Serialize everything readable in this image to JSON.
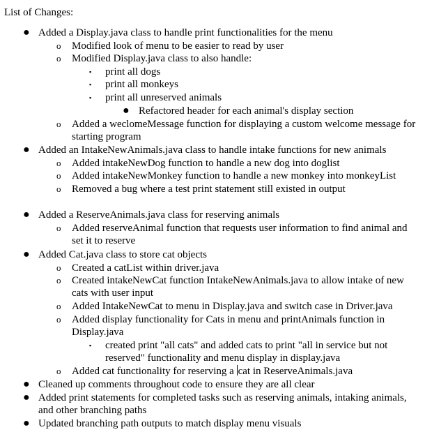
{
  "heading": "List of Changes:",
  "lines": [
    {
      "id": "l1",
      "text": "Added a Display.java class to handle print functionalities for the menu"
    },
    {
      "id": "l2",
      "text": "Modified look of menu to be easier to read by user"
    },
    {
      "id": "l3",
      "text": "Modified Display.java class to also handle:"
    },
    {
      "id": "l4",
      "text": "print all dogs"
    },
    {
      "id": "l5",
      "text": "print all monkeys"
    },
    {
      "id": "l6",
      "text": "print all unreserved animals"
    },
    {
      "id": "l7",
      "text": "Refactored header for each animal's display section"
    },
    {
      "id": "l8",
      "text": "Added a weclomeMessage function for displaying a custom welcome message for"
    },
    {
      "id": "l8b",
      "text": "starting program"
    },
    {
      "id": "l9",
      "text": "Added an IntakeNewAnimals.java class to handle intake functions for new animals"
    },
    {
      "id": "l10",
      "text": "Added intakeNewDog function to handle a new dog into doglist"
    },
    {
      "id": "l11",
      "text": "Added intakeNewMonkey function to handle a new monkey into monkeyList"
    },
    {
      "id": "l12",
      "text": "Removed a bug where a test print statement still existed in output"
    },
    {
      "id": "l13",
      "text": "Added a ReserveAnimals.java class for reserving animals"
    },
    {
      "id": "l14",
      "text": "Added reserveAnimal function that requests user information to find animal and"
    },
    {
      "id": "l14b",
      "text": "set it to reserve"
    },
    {
      "id": "l15",
      "text": "Added Cat.java class to store cat objects"
    },
    {
      "id": "l16",
      "text": "Created a catList within driver.java"
    },
    {
      "id": "l17",
      "text": "Created intakeNewCat function IntakeNewAnimals.java to allow intake of new"
    },
    {
      "id": "l17b",
      "text": "cats with user input"
    },
    {
      "id": "l18",
      "text": "Added IntakeNewCat to menu in Display.java and switch case in Driver.java"
    },
    {
      "id": "l19",
      "text": "Added display functionality for Cats in menu and printAnimals function in"
    },
    {
      "id": "l19b",
      "text": "Display.java"
    },
    {
      "id": "l20",
      "text": "created print \"all cats\" and added cats to print \"all in service but not"
    },
    {
      "id": "l20b",
      "text": "reserved\" functionality and menu display in display.java"
    },
    {
      "id": "l21a",
      "text": "Added cat functionality for reserving a "
    },
    {
      "id": "l21b",
      "text": "cat in ReserveAnimals.java"
    },
    {
      "id": "l22",
      "text": "Cleaned up comments throughout code to ensure they are all clear"
    },
    {
      "id": "l23",
      "text": "Added print statements for completed tasks such as reserving animals, intaking animals,"
    },
    {
      "id": "l23b",
      "text": "and other branching paths"
    },
    {
      "id": "l24",
      "text": "Updated branching path outputs to match display menu visuals"
    }
  ],
  "bullets": {
    "level1": "●",
    "level2": "o",
    "level3": "▪",
    "level4": "●"
  }
}
